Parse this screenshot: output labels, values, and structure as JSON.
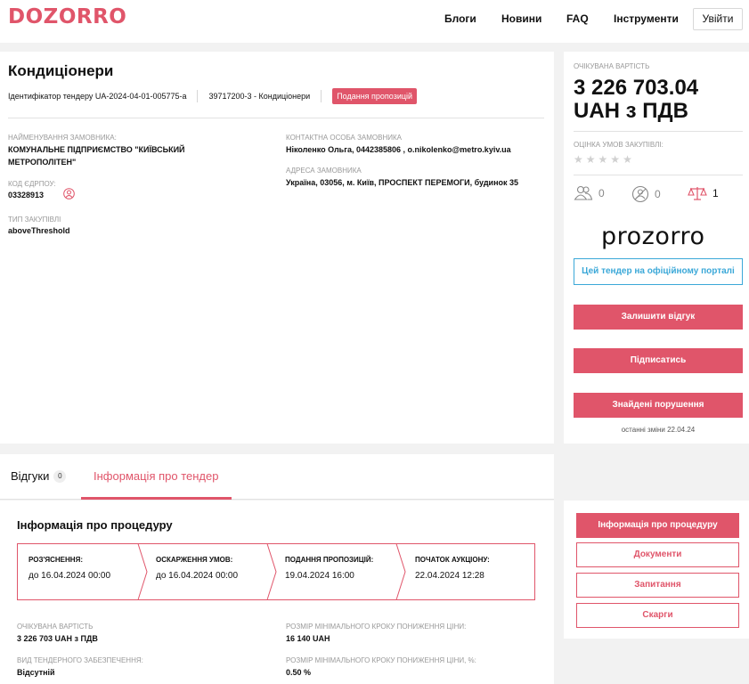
{
  "header": {
    "logo": "DOZORRO",
    "nav": [
      "Блоги",
      "Новини",
      "FAQ",
      "Інструменти"
    ],
    "login": "Увійти"
  },
  "tender": {
    "title": "Кондиціонери",
    "id_text": "Ідентифікатор тендеру UA-2024-04-01-005775-a",
    "cpv": "39717200-3 - Кондиціонери",
    "status": "Подання пропозицій",
    "customer_name_label": "Найменування замовника:",
    "customer_name": "КОМУНАЛЬНЕ ПІДПРИЄМСТВО \"КИЇВСЬКИЙ МЕТРОПОЛІТЕН\"",
    "edrpou_label": "Код ЄДРПОУ:",
    "edrpou": "03328913",
    "procurement_type_label": "Тип закупівлі",
    "procurement_type": "aboveThreshold",
    "contact_label": "Контактна особа замовника",
    "contact": "Ніколенко Ольга, 0442385806 , o.nikolenko@metro.kyiv.ua",
    "address_label": "Адреса замовника",
    "address": "Україна, 03056, м. Київ, ПРОСПЕКТ ПЕРЕМОГИ, будинок 35"
  },
  "sidebar": {
    "expected_value_label": "Очікувана вартість",
    "expected_value": "3 226 703.04 UAH з ПДВ",
    "rating_label": "Оцінка умов закупівлі:",
    "rating": 0,
    "stats": {
      "users": "0",
      "violations": "0",
      "claims": "1"
    },
    "prozorro_logo": "prozorro",
    "portal_button": "Цей тендер на офіційному порталі",
    "review_button": "Залишити відгук",
    "subscribe_button": "Підписатись",
    "violations_button": "Знайдені порушення",
    "last_changes": "останні зміни 22.04.24"
  },
  "tabs": {
    "reviews_label": "Відгуки",
    "reviews_count": "0",
    "info_label": "Інформація про тендер"
  },
  "procedure": {
    "title": "Інформація про процедуру",
    "stages": [
      {
        "label": "Роз'яснення:",
        "date": "до 16.04.2024 00:00"
      },
      {
        "label": "Оскарження умов:",
        "date": "до 16.04.2024 00:00"
      },
      {
        "label": "Подання пропозицій:",
        "date": "19.04.2024 16:00"
      },
      {
        "label": "Початок аукціону:",
        "date": "22.04.2024 12:28"
      }
    ],
    "expected_value_label": "Очікувана вартість",
    "expected_value": "3 226 703 UAH з ПДВ",
    "security_label": "Вид тендерного забезпечення:",
    "security": "Відсутній",
    "min_step_label": "Розмір мінімального кроку пониження ціни:",
    "min_step": "16 140 UAH",
    "min_step_pct_label": "Розмір мінімального кроку пониження ціни, %:",
    "min_step_pct": "0.50 %"
  },
  "procedure_nav": {
    "items": [
      "Інформація про процедуру",
      "Документи",
      "Запитання",
      "Скарги"
    ]
  },
  "colors": {
    "accent": "#e0556a",
    "link": "#3ba8d8"
  }
}
